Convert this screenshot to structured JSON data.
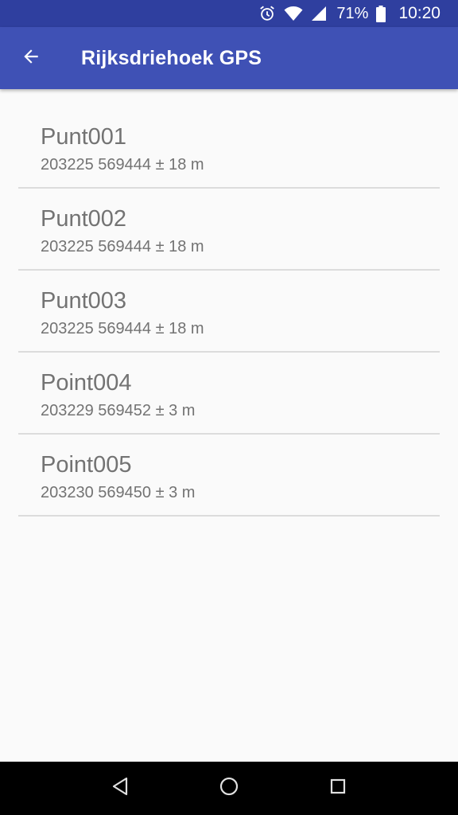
{
  "status_bar": {
    "battery_percent": "71%",
    "time": "10:20",
    "icons": [
      "alarm-icon",
      "wifi-icon",
      "cell-signal-icon",
      "battery-icon"
    ]
  },
  "app_bar": {
    "title": "Rijksdriehoek GPS",
    "back_icon": "arrow-back-icon"
  },
  "points": [
    {
      "name": "Punt001",
      "coords": "203225 569444 ± 18 m"
    },
    {
      "name": "Punt002",
      "coords": "203225 569444 ± 18 m"
    },
    {
      "name": "Punt003",
      "coords": "203225 569444 ± 18 m"
    },
    {
      "name": "Point004",
      "coords": "203229 569452 ± 3 m"
    },
    {
      "name": "Point005",
      "coords": "203230 569450 ± 3 m"
    }
  ],
  "nav_bar": {
    "icons": [
      "nav-back-icon",
      "nav-home-icon",
      "nav-recents-icon"
    ]
  },
  "colors": {
    "primary": "#3f51b5",
    "primary_dark": "#2f3f9f",
    "text_secondary": "#737373",
    "divider": "#dcdcdc",
    "background": "#fafafa"
  }
}
